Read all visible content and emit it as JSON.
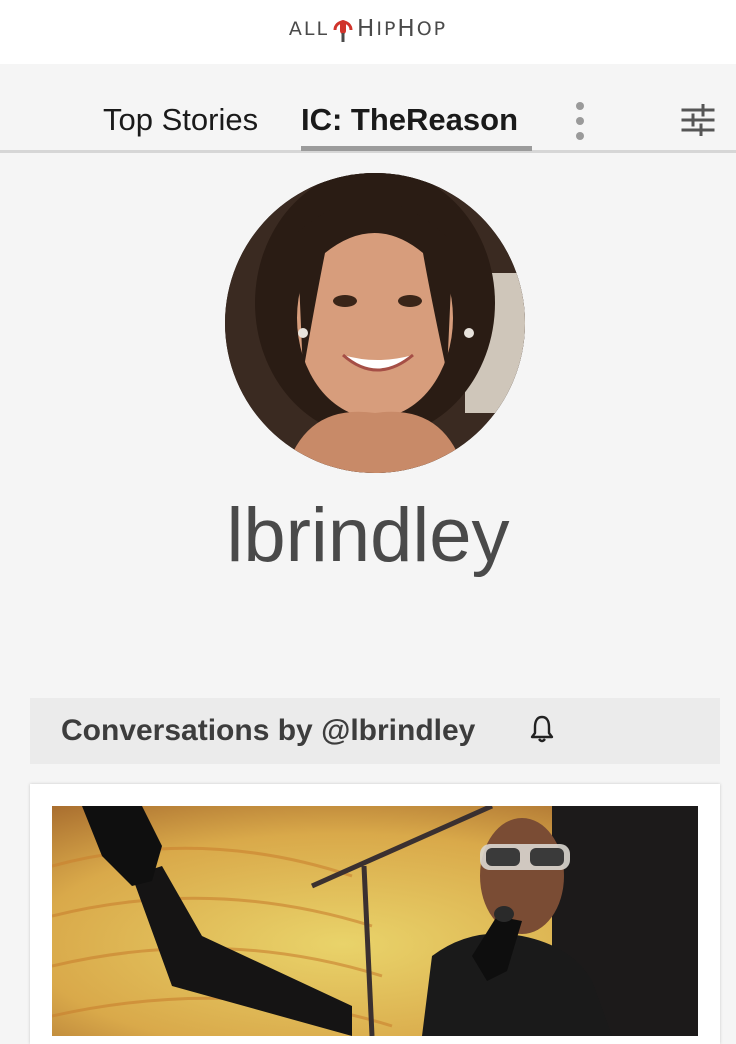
{
  "brand": {
    "logo_left": "ALL",
    "logo_h": "H",
    "logo_middle": "IP",
    "logo_h2": "H",
    "logo_right": "OP"
  },
  "tabs": [
    {
      "label": "Top Stories",
      "active": false
    },
    {
      "label": "IC: TheReason",
      "active": true
    }
  ],
  "profile": {
    "username": "lbrindley"
  },
  "conversations": {
    "title": "Conversations by @lbrindley"
  },
  "icons": {
    "more": "more-vertical-icon",
    "filter": "sliders-icon",
    "bell": "bell-icon",
    "logo_mic": "microphone-icon"
  },
  "colors": {
    "accent_underline": "#9b9b9b",
    "brand_red": "#d0342c",
    "text_dark": "#4a4a4a"
  }
}
